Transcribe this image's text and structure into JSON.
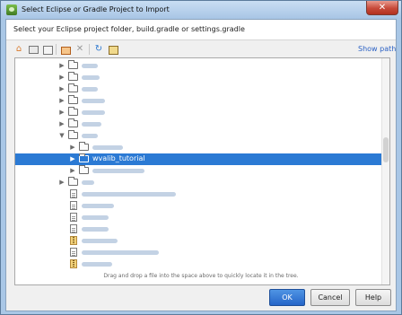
{
  "window": {
    "title": "Select Eclipse or Gradle Project to Import",
    "close_glyph": "✕"
  },
  "header": {
    "instruction": "Select your Eclipse project folder, build.gradle or settings.gradle"
  },
  "toolbar": {
    "show_path_label": "Show path",
    "icons": [
      "home-icon",
      "desktop-icon",
      "project-icon",
      "new-folder-icon",
      "delete-icon",
      "refresh-icon",
      "toggle-hidden-icon"
    ]
  },
  "tree": {
    "selected_label": "wvalib_tutorial",
    "expanded_glyph": "▼",
    "collapsed_glyph": "▶"
  },
  "footer": {
    "hint": "Drag and drop a file into the space above to quickly locate it in the tree.",
    "ok_label": "OK",
    "cancel_label": "Cancel",
    "help_label": "Help"
  },
  "colors": {
    "selection": "#2b7ad4",
    "primary_button": "#2565c8",
    "link": "#2b61c4"
  }
}
